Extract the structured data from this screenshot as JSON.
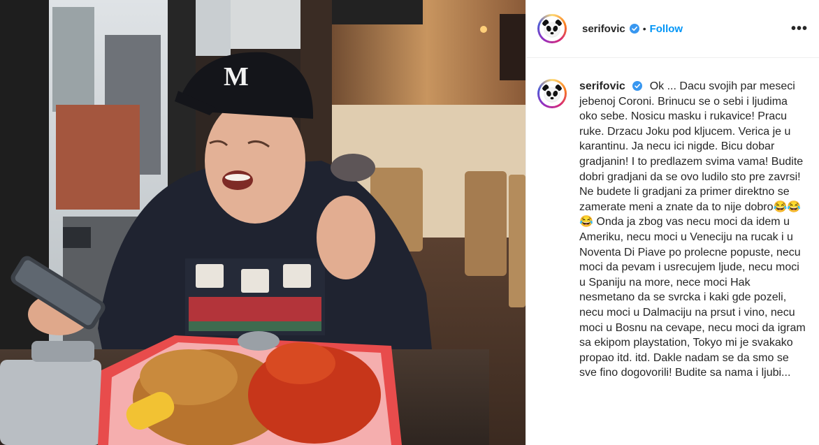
{
  "post": {
    "username": "serifovic",
    "verified": true,
    "separator": "•",
    "follow_label": "Follow",
    "more_label": "•••",
    "caption": "Ok ... Dacu svojih par meseci jebenoj Coroni. Brinucu se o sebi i ljudima oko sebe. Nosicu masku i rukavice! Pracu ruke. Drzacu Joku pod kljucem. Verica je u karantinu. Ja necu ici nigde. Bicu dobar gradjanin! I to predlazem svima vama! Budite dobri gradjani da se ovo ludilo sto pre zavrsi! Ne budete li gradjani za primer direktno se zamerate meni a znate da to nije dobro😂😂😂 Onda ja zbog vas necu moci da idem u Ameriku, necu moci u Veneciju na rucak i u Noventa Di Piave po prolecne popuste, necu moci da pevam i usrecujem ljude, necu moci u Spaniju na more, nece moci Hak nesmetano da se svrcka i kaki gde pozeli, necu moci u Dalmaciju na prsut i vino, necu moci u Bosnu na cevape, necu moci da igram sa ekipom playstation, Tokyo mi je svakako propao itd. itd. Dakle nadam se da smo se sve fino dogovorili! Budite sa nama i ljubi..."
  },
  "icons": {
    "avatar": "panda-avatar",
    "verified": "verified-badge-icon",
    "more": "more-options-icon"
  },
  "colors": {
    "accent": "#0095f6",
    "text": "#262626",
    "border": "#efefef"
  }
}
